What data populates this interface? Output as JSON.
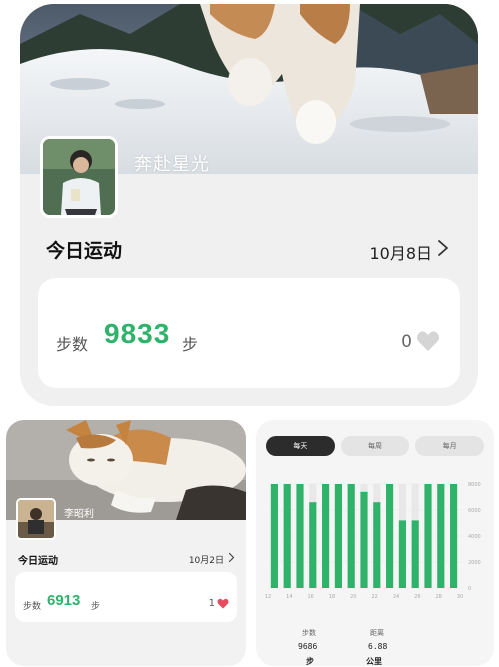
{
  "main_card": {
    "username": "奔赴星光",
    "title": "今日运动",
    "date": "10月8日",
    "steps_label": "步数",
    "steps_value": "9833",
    "steps_unit": "步",
    "likes_count": "0",
    "accent_color": "#2fb36b",
    "chevron_icon": "chevron-right-icon",
    "heart_icon": "heart-outline-icon"
  },
  "small_card": {
    "username": "李昭利",
    "title": "今日运动",
    "date": "10月2日",
    "steps_label": "步数",
    "steps_value": "6913",
    "steps_unit": "步",
    "likes_count": "1",
    "heart_color": "#e84a5f",
    "heart_icon": "heart-filled-icon"
  },
  "chart_card": {
    "tabs": [
      {
        "label": "每天",
        "active": true
      },
      {
        "label": "每周",
        "active": false
      },
      {
        "label": "每月",
        "active": false
      }
    ],
    "summary": {
      "steps_label": "步数",
      "steps_value": "9686",
      "steps_unit": "步",
      "distance_label": "距离",
      "distance_value": "6.88",
      "distance_unit": "公里"
    }
  },
  "chart_data": {
    "type": "bar",
    "categories": [
      "12",
      "",
      "14",
      "",
      "16",
      "",
      "18",
      "",
      "20",
      "",
      "22",
      "",
      "24",
      "",
      "26",
      "",
      "28",
      "",
      "30"
    ],
    "values": [
      8000,
      8000,
      8000,
      6600,
      8000,
      8000,
      8000,
      7400,
      6600,
      8000,
      5200,
      5200,
      8000,
      8000,
      8000
    ],
    "ylim": [
      0,
      8000
    ],
    "yticks": [
      "8000",
      "6000",
      "4000",
      "2000",
      "0"
    ],
    "xlabel": "",
    "ylabel": "",
    "bar_color": "#2fb36b",
    "track_color": "#e8e8e8",
    "grid": true
  }
}
